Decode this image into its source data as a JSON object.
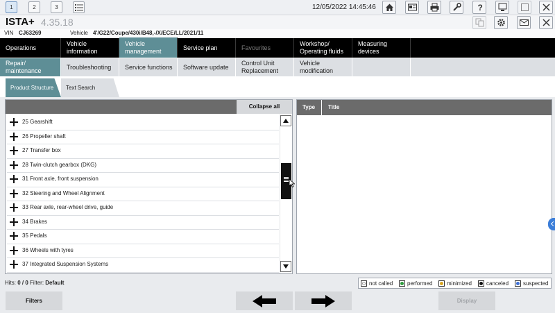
{
  "topbar": {
    "sessions": [
      "1",
      "2",
      "3"
    ],
    "datetime": "12/05/2022 14:45:46",
    "icons": [
      "home-icon",
      "id-card-icon",
      "printer-icon",
      "wrench-icon",
      "help-icon",
      "monitor-icon",
      "restore-window-icon",
      "close-icon"
    ]
  },
  "titlebar": {
    "title": "ISTA+",
    "version": "4.35.18",
    "icons": [
      "copy-icon",
      "gear-icon",
      "mail-icon",
      "close-icon"
    ]
  },
  "vehicle": {
    "vin_label": "VIN",
    "vin": "CJ63269",
    "vehicle_label": "Vehicle",
    "vehicle": "4'/G22/Coupe/430i/B48,-/X/ECE/LL/2021/11"
  },
  "main_nav": [
    {
      "label": "Operations"
    },
    {
      "label": "Vehicle information"
    },
    {
      "label": "Vehicle management"
    },
    {
      "label": "Service plan"
    },
    {
      "label": "Favourites"
    },
    {
      "label": "Workshop/ Operating fluids"
    },
    {
      "label": "Measuring devices"
    }
  ],
  "sub_nav": [
    {
      "label": "Repair/ maintenance"
    },
    {
      "label": "Troubleshooting"
    },
    {
      "label": "Service functions"
    },
    {
      "label": "Software update"
    },
    {
      "label": "Control Unit Replacement"
    },
    {
      "label": "Vehicle modification"
    }
  ],
  "third_nav": [
    {
      "label": "Product Structure"
    },
    {
      "label": "Text Search"
    }
  ],
  "tree": {
    "collapse_label": "Collapse all",
    "items": [
      "25 Gearshift",
      "26 Propeller shaft",
      "27 Transfer box",
      "28 Twin-clutch gearbox (DKG)",
      "31 Front axle, front suspension",
      "32 Steering and Wheel Alignment",
      "33 Rear axle, rear-wheel drive, guide",
      "34 Brakes",
      "35 Pedals",
      "36 Wheels with tyres",
      "37 Integrated Suspension Systems"
    ]
  },
  "results": {
    "col_type": "Type",
    "col_title": "Title"
  },
  "status": {
    "hits_label": "Hits:",
    "hits": "0 / 0",
    "filter_label": "Filter:",
    "filter": "Default"
  },
  "legend": [
    {
      "label": "not called",
      "color": "#ffffff"
    },
    {
      "label": "performed",
      "color": "#2e9b3e"
    },
    {
      "label": "minimized",
      "color": "#d9a520"
    },
    {
      "label": "canceled",
      "color": "#111111"
    },
    {
      "label": "suspected",
      "color": "#3d6fd6"
    }
  ],
  "bottom": {
    "filters_label": "Filters",
    "display_label": "Display"
  },
  "colors": {
    "accent": "#5e8e96",
    "nav_bg": "#000000",
    "header_grey": "#6b6b6b"
  }
}
